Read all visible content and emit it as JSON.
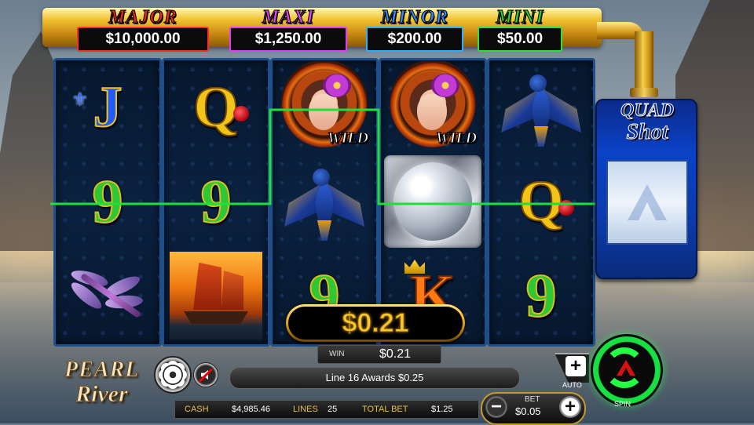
{
  "jackpots": [
    {
      "label": "MAJOR",
      "amount": "$10,000.00",
      "color": "#ff2b2b"
    },
    {
      "label": "MAXI",
      "amount": "$1,250.00",
      "color": "#e03cff"
    },
    {
      "label": "MINOR",
      "amount": "$200.00",
      "color": "#2db0ff"
    },
    {
      "label": "MINI",
      "amount": "$50.00",
      "color": "#2ee03f"
    }
  ],
  "reels": [
    [
      "J",
      "9",
      "dragonfly"
    ],
    [
      "Q",
      "9",
      "junk-ship"
    ],
    [
      "wild",
      "crane",
      "9"
    ],
    [
      "wild",
      "pearl",
      "K"
    ],
    [
      "crane",
      "Q",
      "9"
    ]
  ],
  "wild_label": "WILD",
  "quad_shot": {
    "line1": "QUAD",
    "line2": "Shot"
  },
  "logo": {
    "line1": "PEARL",
    "line2": "River"
  },
  "win_display": "$0.21",
  "win_bar": {
    "label": "WIN",
    "value": "$0.21"
  },
  "message": "Line 16 Awards $0.25",
  "stats": {
    "cash_label": "CASH",
    "cash_value": "$4,985.46",
    "lines_label": "LINES",
    "lines_value": "25",
    "total_bet_label": "TOTAL BET",
    "total_bet_value": "$1.25"
  },
  "bet": {
    "label": "BET",
    "value": "$0.05",
    "minus": "−",
    "plus": "+"
  },
  "auto": {
    "plus": "+",
    "label": "AUTO"
  },
  "spin_label": "SPIN",
  "colors": {
    "payline": "#1ee03a",
    "reel_border": "#1b4f8e",
    "gold": "#f3bb28"
  }
}
